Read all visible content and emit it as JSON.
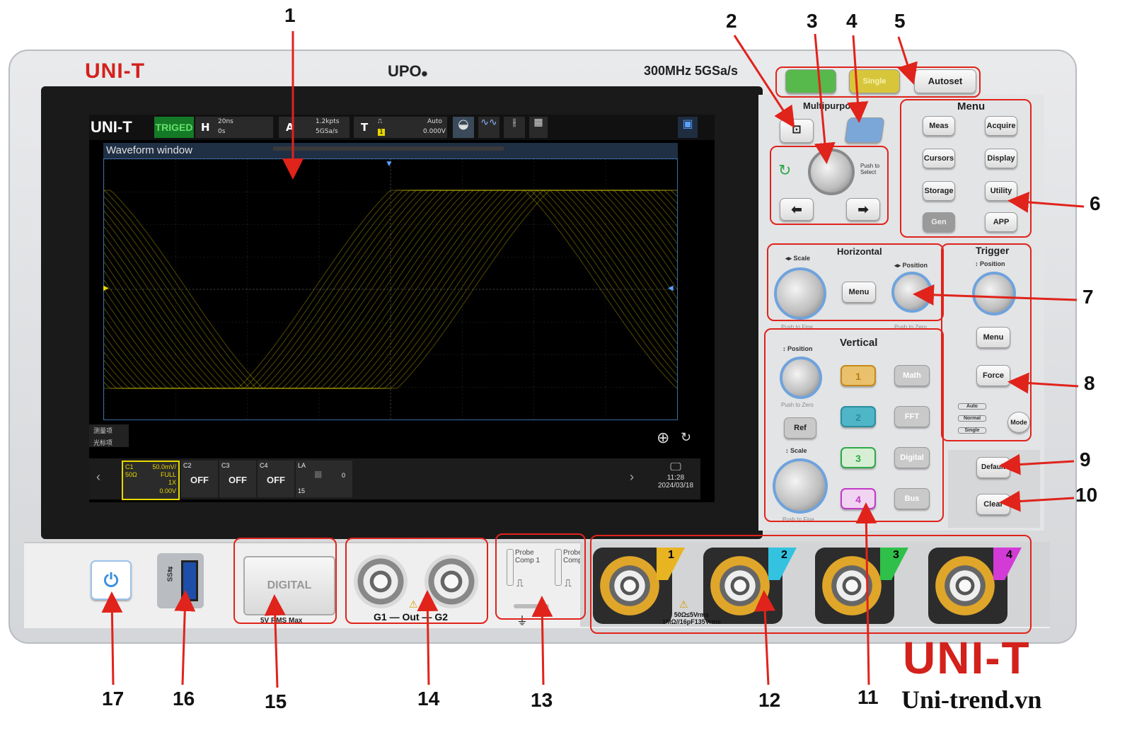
{
  "brand": "UNI-T",
  "model": "UPO",
  "spec": "300MHz  5GSa/s",
  "screen": {
    "logo": "UNI-T",
    "status": "TRIGED",
    "h_label": "H",
    "timebase": "20ns",
    "h_offset": "0s",
    "acq_label": "A",
    "mem_depth": "1.2kpts",
    "sample_rate": "5GSa/s",
    "trig_label": "T",
    "trig_source": "1",
    "trig_mode": "Auto",
    "trig_level": "0.000V",
    "waveform_window": "Waveform window",
    "side_tabs": [
      "测量项",
      "光标项"
    ],
    "channels": [
      {
        "name": "C1",
        "scale": "50.0mV/",
        "coupling": "50Ω",
        "bw": "FULL",
        "probe": "1X",
        "offset": "0.00V",
        "state": ""
      },
      {
        "name": "C2",
        "state": "OFF"
      },
      {
        "name": "C3",
        "state": "OFF"
      },
      {
        "name": "C4",
        "state": "OFF"
      },
      {
        "name": "LA",
        "count_start": "0",
        "count_end": "15",
        "state": ""
      }
    ],
    "time": "11:28",
    "date": "2024/03/18"
  },
  "panel": {
    "run_stop": "",
    "single": "Single",
    "autoset": "Autoset",
    "multipurpose_title": "Multipurpose",
    "push_to_select": "Push to Select",
    "menu_title": "Menu",
    "menu_buttons": [
      "Meas",
      "Acquire",
      "Cursors",
      "Display",
      "Storage",
      "Utility",
      "Gen",
      "APP"
    ],
    "horizontal_title": "Horizontal",
    "h_scale": "Scale",
    "h_position": "Position",
    "h_menu": "Menu",
    "h_push_fine": "Push to Fine",
    "h_push_zero": "Push to Zero",
    "vertical_title": "Vertical",
    "v_position": "Position",
    "v_push_zero": "Push to Zero",
    "v_scale": "Scale",
    "v_push_fine": "Push to Fine",
    "ref": "Ref",
    "ch_buttons": [
      "1",
      "2",
      "3",
      "4"
    ],
    "func_buttons": [
      "Math",
      "FFT",
      "Digital",
      "Bus"
    ],
    "trigger_title": "Trigger",
    "t_position": "Position",
    "t_menu": "Menu",
    "force": "Force",
    "modes": [
      "Auto",
      "Normal",
      "Single"
    ],
    "mode": "Mode",
    "default": "Default",
    "clear": "Clear"
  },
  "front": {
    "digital": "DIGITAL",
    "digital_max": "5V RMS Max",
    "gen_label": "G1 — Out — G2",
    "probe_comp_1": "Probe Comp 1",
    "probe_comp_2": "Probe Comp 2",
    "input_rating_1": "50Ω≤5Vrms",
    "input_rating_2": "1MΩ//16pF135Vrms",
    "inputs": [
      "1",
      "2",
      "3",
      "4"
    ]
  },
  "callouts": [
    "1",
    "2",
    "3",
    "4",
    "5",
    "6",
    "7",
    "8",
    "9",
    "10",
    "11",
    "12",
    "13",
    "14",
    "15",
    "16",
    "17"
  ],
  "watermark": {
    "brand": "UNI-T",
    "site": "Uni-trend.vn"
  },
  "colors": {
    "ch1": "#e8d800",
    "ch2": "#33c3e0",
    "ch3": "#2fc04a",
    "ch4": "#d23bd6",
    "callout": "#e0231b"
  }
}
